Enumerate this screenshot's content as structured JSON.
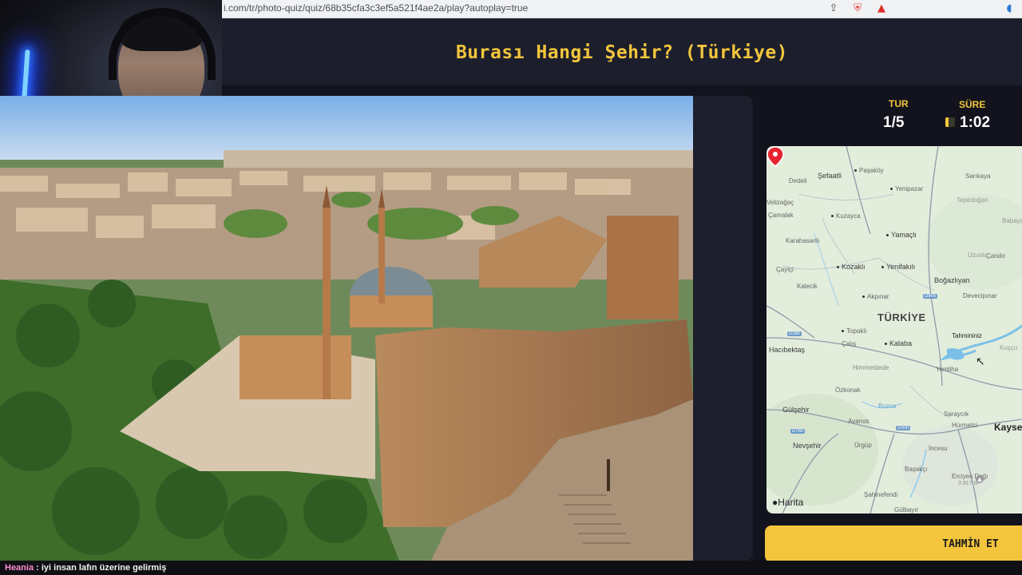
{
  "browser": {
    "url": "i.com/tr/photo-quiz/quiz/68b35cfa3c3ef5a521f4ae2a/play?autoplay=true"
  },
  "quiz": {
    "title": "Burası Hangi Şehir? (Türkiye)"
  },
  "stats": {
    "round_label": "TUR",
    "round_value": "1/5",
    "time_label": "SÜRE",
    "time_value": "1:02"
  },
  "map": {
    "country_label": "TÜRKİYE",
    "pin_label": "Tahmininiz",
    "big_city": "Kayse",
    "attribution": "Harita",
    "places": {
      "sefaatli": "Şefaatli",
      "dedeli": "Dedeli",
      "pasakoy": "Paşaköy",
      "sarikaya": "Sarıkaya",
      "yenipazar": "Yenipazar",
      "valizagac": "Velizağaç",
      "camalak": "Çamalak",
      "kuzayca": "Kuzayca",
      "tepedogan": "Tepedoğan",
      "babayagmur": "Babayağ",
      "karahasanli": "Karahasanlı",
      "yamacli": "Yamaçlı",
      "uzunlu": "Uzunlu",
      "candir": "Çandır",
      "cayici": "Çayiçi",
      "kozakli": "Kozaklı",
      "yenifakili": "Yenifakılı",
      "bogazliyan": "Boğazlıyan",
      "kalecik": "Kalecik",
      "akpinar": "Akpınar",
      "devecipinar": "Devecipınar",
      "topakli": "Topaklı",
      "calis": "Çalış",
      "kalaba": "Kalaba",
      "hacibektas": "Hacıbektaş",
      "himmetdede": "Himmetdede",
      "yemliha": "Yemliha",
      "kuscu": "Kuşçu",
      "ozkonak": "Özkonak",
      "gulsehir": "Gülşehir",
      "avanos": "Avanos",
      "bozca": "Bozca",
      "saraycik": "Saraycık",
      "hurmetci": "Hürmetci",
      "nevsehir": "Nevşehir",
      "urgup": "Ürgüp",
      "incesu": "İncesu",
      "basakci": "Başakçı",
      "erciyes": "Erciyes Dağı",
      "erciyes_height": "3.917 m",
      "sahinefendi": "Şahinefendi",
      "gulbayir": "Gülbayır"
    },
    "road_badges": {
      "b280": "D260",
      "b180": "D805",
      "b300": "D300",
      "b765": "D765"
    }
  },
  "actions": {
    "guess_button": "TAHMİN ET"
  },
  "chat": {
    "user": "Heania",
    "message": "iyi insan lafın üzerine gelirmiş"
  },
  "colors": {
    "accent": "#f3c53c",
    "header_bg": "#1c1e2c",
    "page_bg": "#12131c",
    "pin": "#e5242f"
  },
  "icons": [
    "share-icon",
    "brave-shield-icon",
    "warning-triangle-icon",
    "speaker-icon",
    "map-pin-icon",
    "apple-logo-icon",
    "cursor-icon"
  ],
  "timer_fraction": 0.35
}
